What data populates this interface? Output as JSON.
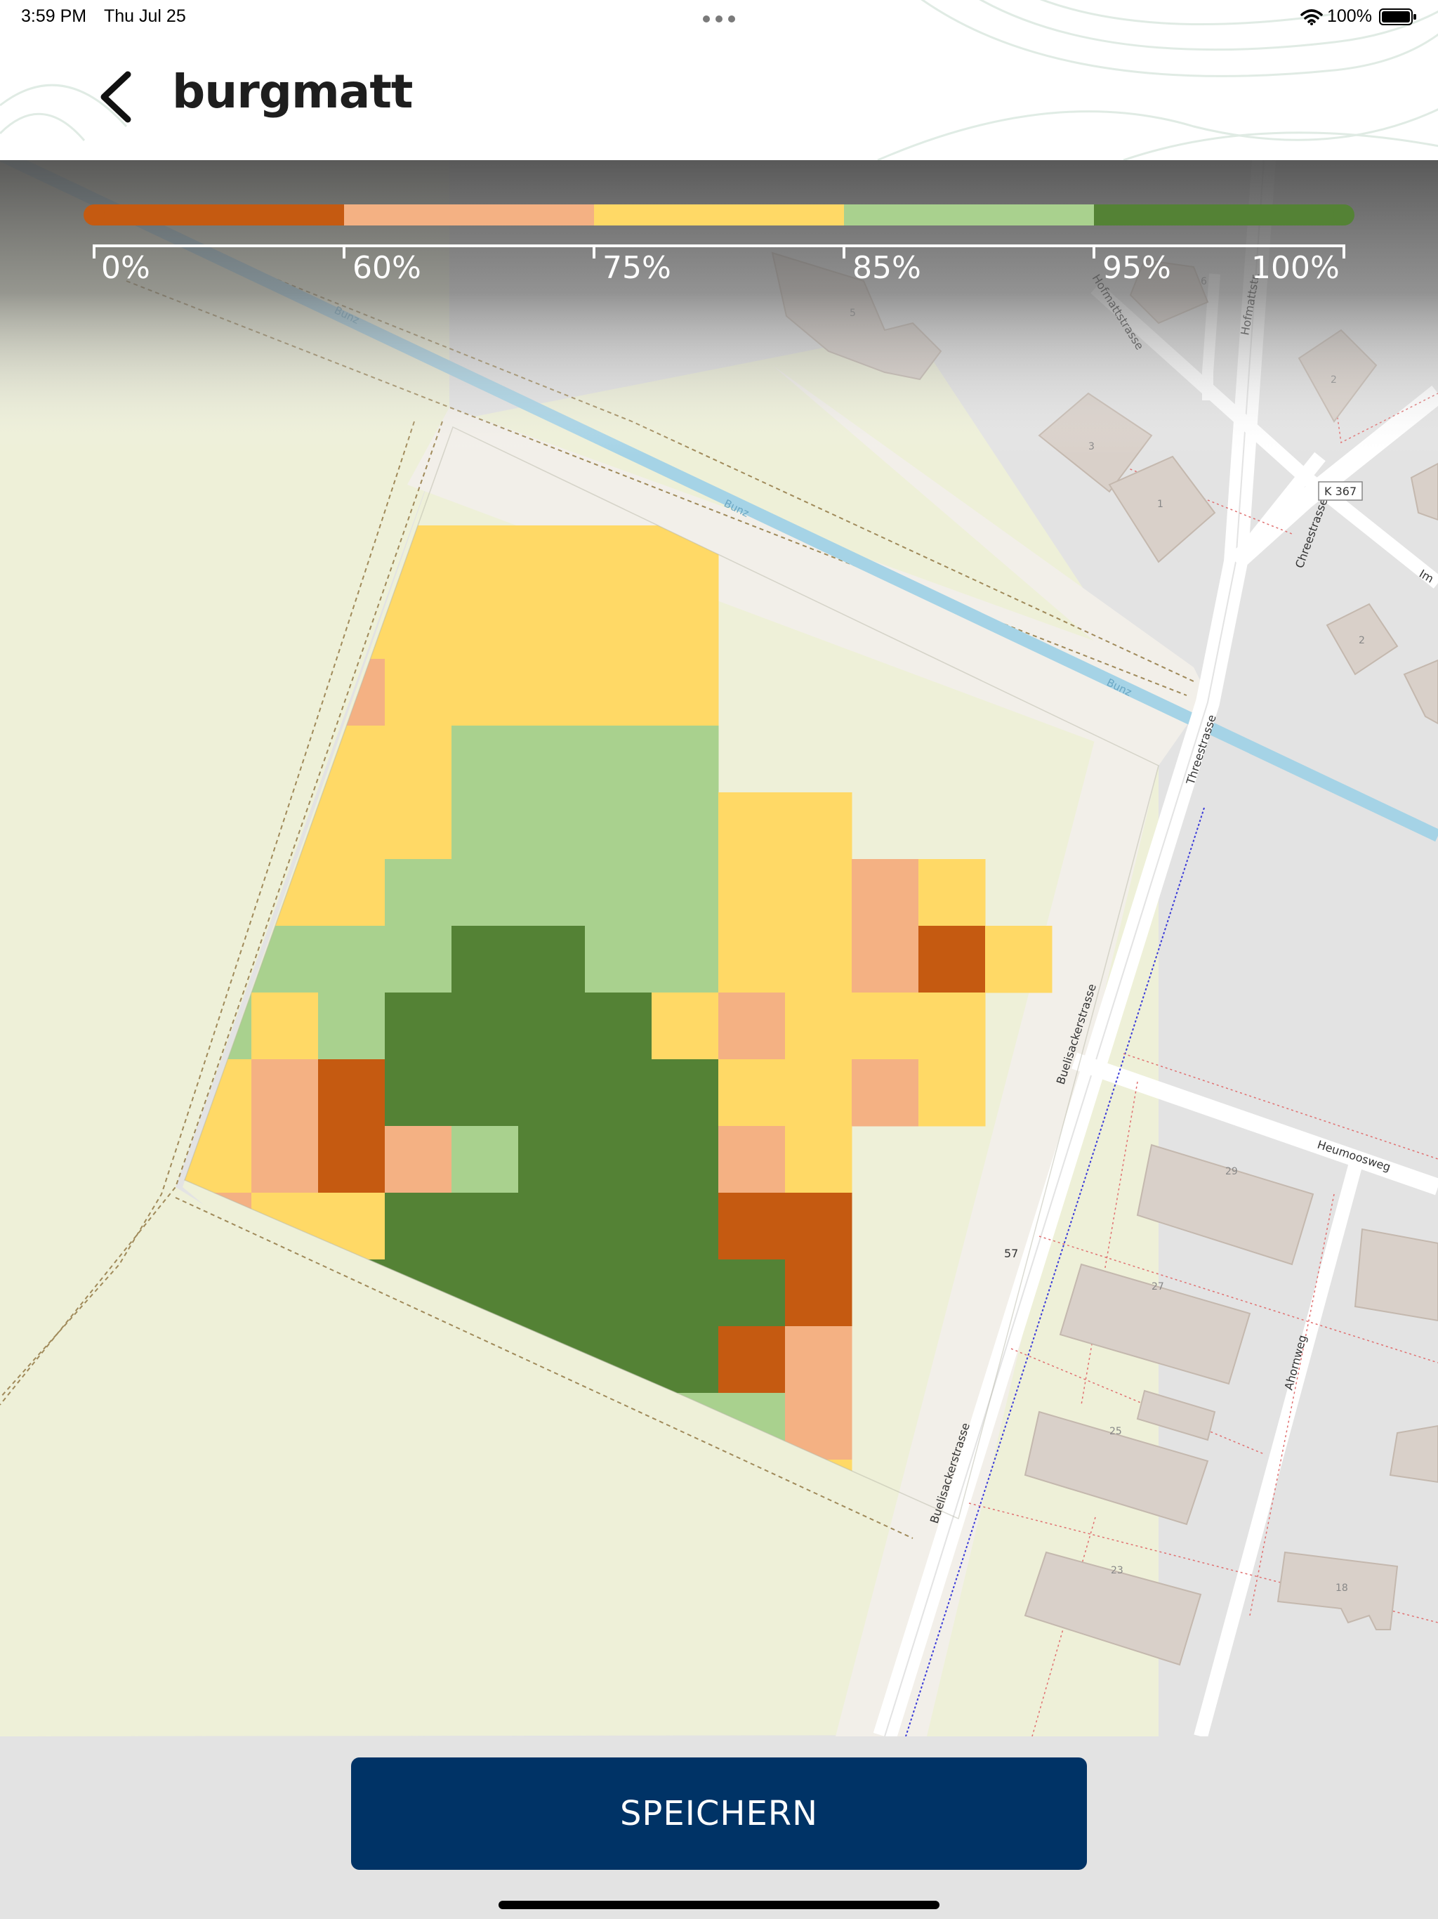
{
  "status_bar": {
    "time": "3:59 PM",
    "date": "Thu Jul 25",
    "battery_text": "100%"
  },
  "header": {
    "title": "burgmatt"
  },
  "legend": {
    "colors": [
      "#c55a11",
      "#f4b183",
      "#ffd966",
      "#a9d18e",
      "#548235"
    ],
    "labels": [
      "0%",
      "60%",
      "75%",
      "85%",
      "95%",
      "100%"
    ]
  },
  "map_labels": {
    "river": "Bunz",
    "street_hofmatt": "Hofmattstrasse",
    "street_hofmatt_short": "Hofmattstr.",
    "road_badge": "K 367",
    "road_badge_partial": "57",
    "street_chree": "Chreestrasse",
    "street_im": "Im",
    "street_three": "Threestrasse",
    "street_bueli_upper": "Buelisackerstrasse",
    "street_bueli_lower": "Buelisackerstrasse",
    "street_heumoos": "Heumoosweg",
    "street_ahorn": "Ahornweg",
    "house_numbers": [
      "5",
      "6",
      "3",
      "1",
      "2",
      "2",
      "29",
      "27",
      "25",
      "23",
      "18"
    ]
  },
  "grid": {
    "rows": [
      "..............",
      "..............",
      "YYYYYYYYY.....",
      "YYYYYYYYY.....",
      "YYYOYYYYY.....",
      "OYYYYGGGG.....",
      "YOYYYGGGGYY...",
      "YYYYGGGGGYYOY.",
      "GYGGGDDGGYYOSY",
      "YGYGDDDDYOYYY.",
      "YYOSDDDDDYYOY.",
      "OYOSOGDDDOY...",
      "OOYYDDDDDSS...",
      "OODDDDDDDDS...",
      "OOODDDDDDSO...",
      "...DDDDDGGO...",
      ".....DDDYYY...",
      ".....YYYOY....",
      "......YYYY....",
      ".............."
    ],
    "legend": {
      "S": "#c55a11",
      "O": "#f4b183",
      "Y": "#ffd966",
      "G": "#a9d18e",
      "D": "#548235"
    }
  },
  "save_button": {
    "label": "SPEICHERN"
  }
}
